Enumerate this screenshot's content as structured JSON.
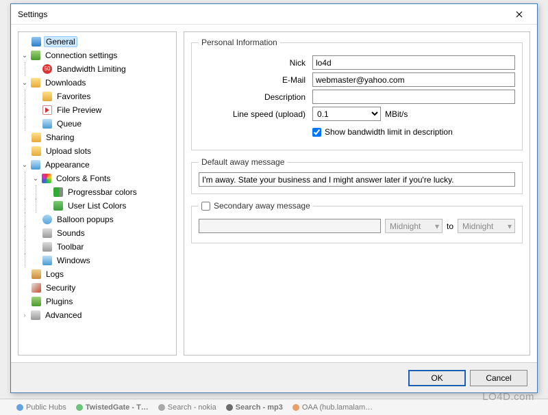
{
  "window": {
    "title": "Settings",
    "ok": "OK",
    "cancel": "Cancel"
  },
  "tree": {
    "general": "General",
    "connection": "Connection settings",
    "bandwidth_limiting": "Bandwidth Limiting",
    "downloads": "Downloads",
    "favorites": "Favorites",
    "file_preview": "File Preview",
    "queue": "Queue",
    "sharing": "Sharing",
    "upload_slots": "Upload slots",
    "appearance": "Appearance",
    "colors_fonts": "Colors & Fonts",
    "progressbar_colors": "Progressbar colors",
    "userlist_colors": "User List Colors",
    "balloon_popups": "Balloon popups",
    "sounds": "Sounds",
    "toolbar": "Toolbar",
    "windows": "Windows",
    "logs": "Logs",
    "security": "Security",
    "plugins": "Plugins",
    "advanced": "Advanced"
  },
  "form": {
    "personal_info_legend": "Personal Information",
    "nick_label": "Nick",
    "nick_value": "lo4d",
    "email_label": "E-Mail",
    "email_value": "webmaster@yahoo.com",
    "description_label": "Description",
    "description_value": "",
    "linespeed_label": "Line speed (upload)",
    "linespeed_value": "0.1",
    "linespeed_unit": "MBit/s",
    "show_bandwidth_label": "Show bandwidth limit in description",
    "default_away_legend": "Default away message",
    "default_away_value": "I'm away. State your business and I might answer later if you're lucky.",
    "secondary_away_label": "Secondary away message",
    "secondary_away_value": "",
    "time_from": "Midnight",
    "time_to_label": "to",
    "time_to": "Midnight"
  },
  "taskbar": {
    "t1": "Public Hubs",
    "t2": "TwistedGate - T…",
    "t3": "Search - nokia",
    "t4": "Search - mp3",
    "t5": "OAA (hub.lamalam…"
  },
  "watermark": "LO4D.com"
}
